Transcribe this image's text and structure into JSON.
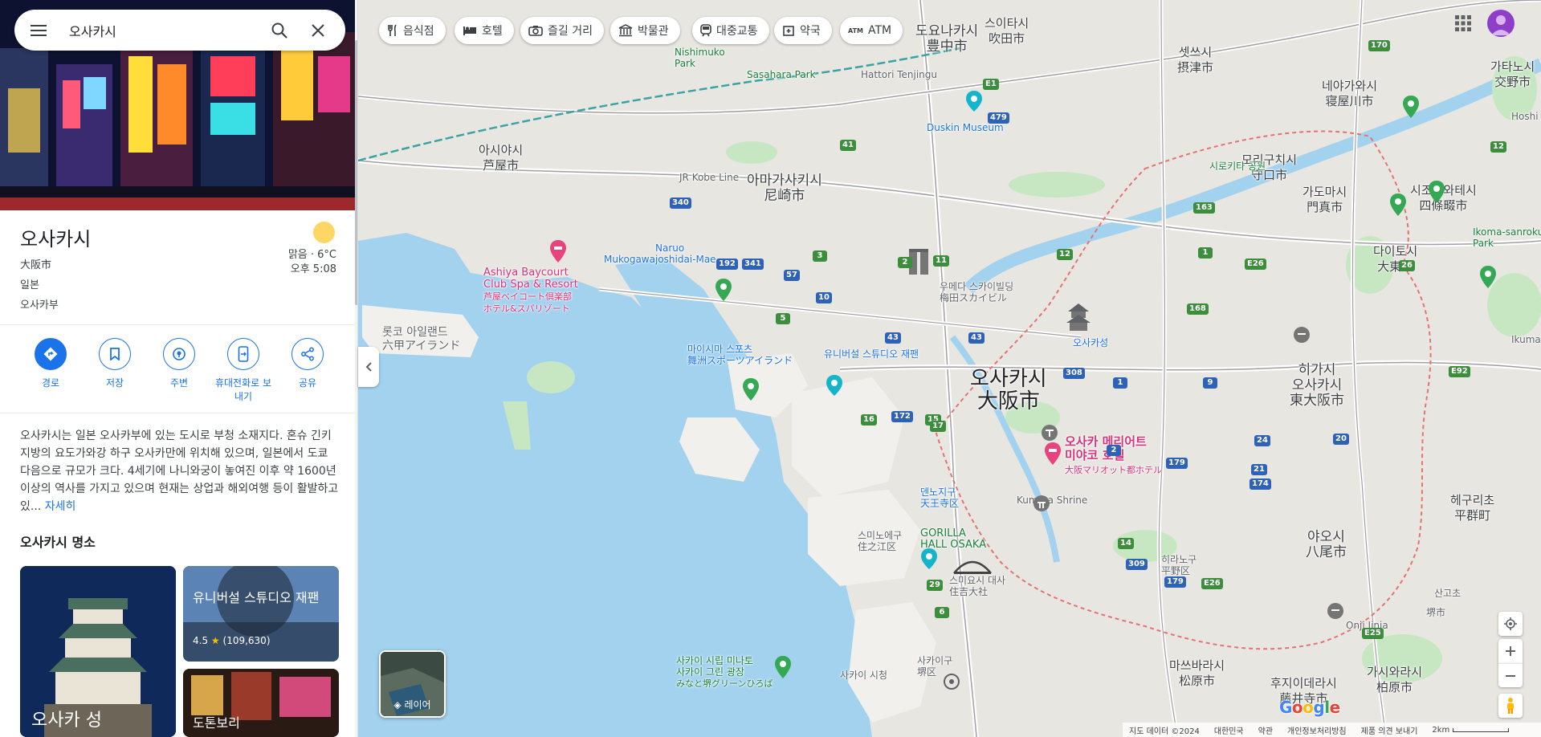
{
  "search": {
    "query": "오사카시",
    "menu_icon": "hamburger-menu-icon",
    "search_icon": "magnifier-icon",
    "close_icon": "close-x-icon"
  },
  "place": {
    "title": "오사카시",
    "sub1": "大阪市",
    "sub2": "일본",
    "sub3": "오사카부",
    "weather": "맑음 · 6°C",
    "time": "오후 5:08"
  },
  "actions": [
    {
      "label": "경로",
      "icon": "directions-icon"
    },
    {
      "label": "저장",
      "icon": "bookmark-icon"
    },
    {
      "label": "주변",
      "icon": "nearby-icon"
    },
    {
      "label": "휴대전화로 보내기",
      "icon": "send-to-phone-icon"
    },
    {
      "label": "공유",
      "icon": "share-icon"
    }
  ],
  "description": {
    "text": "오사카시는 일본 오사카부에 있는 도시로 부청 소재지다. 혼슈 긴키 지방의 요도가와강 하구 오사카만에 위치해 있으며, 일본에서 도쿄 다음으로 규모가 크다. 4세기에 나니와궁이 놓여진 이후 약 1600년 이상의 역사를 가지고 있으며 현재는 상업과 해외여행 등이 활발하고 있...",
    "more": "자세히"
  },
  "sights": {
    "title": "오사카시 명소",
    "cards": [
      {
        "name": "오사카 성"
      },
      {
        "name": "유니버설 스튜디오 재팬",
        "rating": "4.5",
        "reviews": "(109,630)"
      },
      {
        "name": "도톤보리"
      }
    ]
  },
  "chips": [
    {
      "label": "음식점",
      "icon": "restaurant-icon"
    },
    {
      "label": "호텔",
      "icon": "hotel-icon"
    },
    {
      "label": "즐길 거리",
      "icon": "camera-icon"
    },
    {
      "label": "박물관",
      "icon": "museum-icon"
    },
    {
      "label": "대중교통",
      "icon": "transit-icon"
    },
    {
      "label": "약국",
      "icon": "pharmacy-icon"
    },
    {
      "label": "ATM",
      "icon": "atm-icon"
    }
  ],
  "map": {
    "labels": {
      "toyonaka": "도요나카시",
      "toyonaka_jp": "豊中市",
      "suita": "스이타시",
      "suita_jp": "吹田市",
      "settsu": "셋쓰시",
      "settsu_jp": "摂津市",
      "neyagawa": "네야가와시",
      "neyagawa_jp": "寝屋川市",
      "katano": "가타노시",
      "katano_jp": "交野市",
      "ashiya": "아시야시",
      "ashiya_jp": "芦屋市",
      "amagasaki": "아마가사키시",
      "amagasaki_jp": "尼崎市",
      "moriguchi": "모리구치시",
      "moriguchi_jp": "守口市",
      "kadoma": "가도마시",
      "kadoma_jp": "門真市",
      "shijonawate": "시조나와테시",
      "shijonawate_jp": "四條畷市",
      "daito": "다이토시",
      "daito_jp": "大東市",
      "osaka": "오사카시",
      "osaka_jp": "大阪市",
      "higashiosaka": "히가시",
      "higashiosaka2": "오사카시",
      "higashiosaka_jp": "東大阪市",
      "yao": "야오시",
      "yao_jp": "八尾市",
      "matsubara": "마쓰바라시",
      "matsubara_jp": "松原市",
      "fujiidera": "후지이데라시",
      "fujiidera_jp": "藤井寺市",
      "kashiwara": "가시와라시",
      "kashiwara_jp": "柏原市",
      "heguri": "헤구리초",
      "heguri_jp": "平群町",
      "sango": "산고초",
      "rokko": "롯코 아일랜드",
      "rokko_jp": "六甲アイランド",
      "umeda": "우메다 스카이빌딩",
      "umeda_jp": "梅田スカイビル",
      "osakacastle": "오사카성",
      "marriott": "오사카 메리어트",
      "marriott2": "미야코 호텔",
      "marriott_jp": "大阪マリオット都ホテル",
      "ashiya_bay": "Ashiya Baycourt",
      "ashiya_bay2": "Club Spa & Resort",
      "ashiya_bay_jp": "芦屋ベイコート倶楽部",
      "ashiya_bay_jp2": "ホテル&スパリゾート",
      "kumata": "Kumata Shrine",
      "gorilla": "GORILLA",
      "gorilla2": "HALL OSAKA",
      "sakai_park": "사카이 시립 미나토",
      "sakai_park2": "사카이 그린 광장",
      "sakai_park_jp": "みなと堺グリーンひろば",
      "sakai_city": "사카이 시청",
      "tenjingu": "Hattori Tenjingu",
      "sasahara": "Sasahara Park",
      "nishimuko": "Nishimuko",
      "nishimuko2": "Park",
      "duskin": "Duskin Museum",
      "ikoma": "Ikoma-sanroku",
      "ikoma2": "Park",
      "naruo": "Naruo",
      "mukogawa": "Mukogawajoshidai-Mae",
      "jrkobe": "JR Kobe Line",
      "hirano": "히라노구",
      "hirano_jp": "平野区",
      "sumiyoshi": "스미노에구",
      "sumiyoshi_jp": "住之江区",
      "sakai_ku": "사카이구",
      "sakai_ku_jp": "堺区",
      "onji": "Onji Jinja",
      "hoshi": "Hoshi",
      "ikumass": "Ikumass",
      "univ": "유니버설 스튜디오 재팬",
      "maishima": "마이시마 스포츠",
      "tennoji": "덴노지구",
      "tennoji_jp": "天王寺区",
      "sumiyoshi_taisha": "스미요시 대사",
      "sumiyoshi_taisha_jp": "住吉大社",
      "maishima_jp": "舞洲スポーツアイランド",
      "sakai_city_jp": "堺市",
      "shiromi": "시로키타 공원"
    },
    "routes_green": [
      "12",
      "41",
      "170",
      "163",
      "168",
      "15",
      "1",
      "2",
      "11",
      "3",
      "5",
      "16",
      "17",
      "14",
      "26",
      "29",
      "6",
      "12",
      "20",
      "24",
      "174",
      "179",
      "21",
      "9",
      "340",
      "192",
      "341",
      "57",
      "10",
      "43",
      "172",
      "179",
      "309"
    ],
    "routes_blue": [
      "1",
      "2",
      "479",
      "308",
      "43",
      "E1",
      "E26",
      "E25",
      "E92",
      "E26"
    ]
  },
  "layers": {
    "label": "레이어"
  },
  "attribution": {
    "data": "지도 데이터 ©2024",
    "country": "대한민국",
    "terms": "약관",
    "privacy": "개인정보처리방침",
    "feedback": "제품 의견 보내기",
    "scale": "2km"
  },
  "google_logo": "Google",
  "colors": {
    "accent": "#1a73e8",
    "water": "#9fd3f0",
    "land": "#e9e7e2",
    "park": "#c7e7c3",
    "pink": "#d93077"
  }
}
